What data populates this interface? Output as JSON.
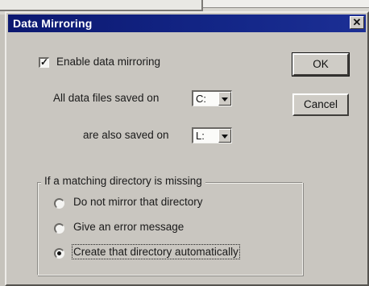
{
  "dialog": {
    "title": "Data Mirroring",
    "close_glyph": "✕"
  },
  "enable_checkbox": {
    "label": "Enable data mirroring",
    "checked": true
  },
  "saved_on": {
    "label": "All data files saved on",
    "value": "C:"
  },
  "also_saved_on": {
    "label": "are also saved on",
    "value": "L:"
  },
  "buttons": {
    "ok_label": "OK",
    "cancel_label": "Cancel"
  },
  "missing_dir_group": {
    "legend": "If a matching directory is missing",
    "options": [
      {
        "label": "Do not mirror that directory",
        "selected": false
      },
      {
        "label": "Give an error message",
        "selected": false
      },
      {
        "label": "Create that directory automatically",
        "selected": true
      }
    ]
  },
  "colors": {
    "titlebar": "#132687",
    "dialog_face": "#c9c6c0"
  },
  "icons": {
    "close": "close-icon",
    "dropdown": "chevron-down-icon"
  }
}
